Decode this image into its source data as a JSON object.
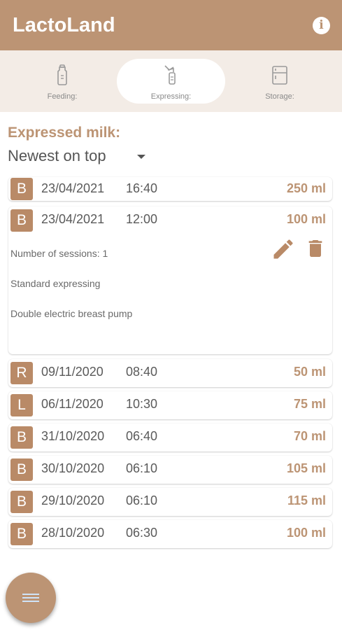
{
  "app": {
    "title": "LactoLand",
    "info_icon": "info-icon",
    "info_glyph": "i"
  },
  "tabs": [
    {
      "label": "Feeding:",
      "icon": "bottle-icon",
      "active": false
    },
    {
      "label": "Expressing:",
      "icon": "breast-pump-icon",
      "active": true
    },
    {
      "label": "Storage:",
      "icon": "fridge-icon",
      "active": false
    }
  ],
  "main": {
    "section_title": "Expressed milk:",
    "sort": {
      "selected": "Newest on top"
    }
  },
  "entries": [
    {
      "side": "B",
      "date": "23/04/2021",
      "time": "16:40",
      "amount": "250 ml",
      "expanded": false
    },
    {
      "side": "B",
      "date": "23/04/2021",
      "time": "12:00",
      "amount": "100 ml",
      "expanded": true,
      "details": {
        "sessions": "Number of sessions: 1",
        "type": "Standard expressing",
        "pump": "Double electric breast pump"
      }
    },
    {
      "side": "R",
      "date": "09/11/2020",
      "time": "08:40",
      "amount": "50 ml",
      "expanded": false
    },
    {
      "side": "L",
      "date": "06/11/2020",
      "time": "10:30",
      "amount": "75 ml",
      "expanded": false
    },
    {
      "side": "B",
      "date": "31/10/2020",
      "time": "06:40",
      "amount": "70 ml",
      "expanded": false
    },
    {
      "side": "B",
      "date": "30/10/2020",
      "time": "06:10",
      "amount": "105 ml",
      "expanded": false
    },
    {
      "side": "B",
      "date": "29/10/2020",
      "time": "06:10",
      "amount": "115 ml",
      "expanded": false
    },
    {
      "side": "B",
      "date": "28/10/2020",
      "time": "06:30",
      "amount": "100 ml",
      "expanded": false
    }
  ],
  "fab": {
    "icon": "menu-icon"
  },
  "colors": {
    "brand": "#bc9474",
    "badge": "#b98a67",
    "tab_bar": "#f3ece6",
    "background": "#ffffff",
    "fab_icon": "#cfe3f8"
  }
}
